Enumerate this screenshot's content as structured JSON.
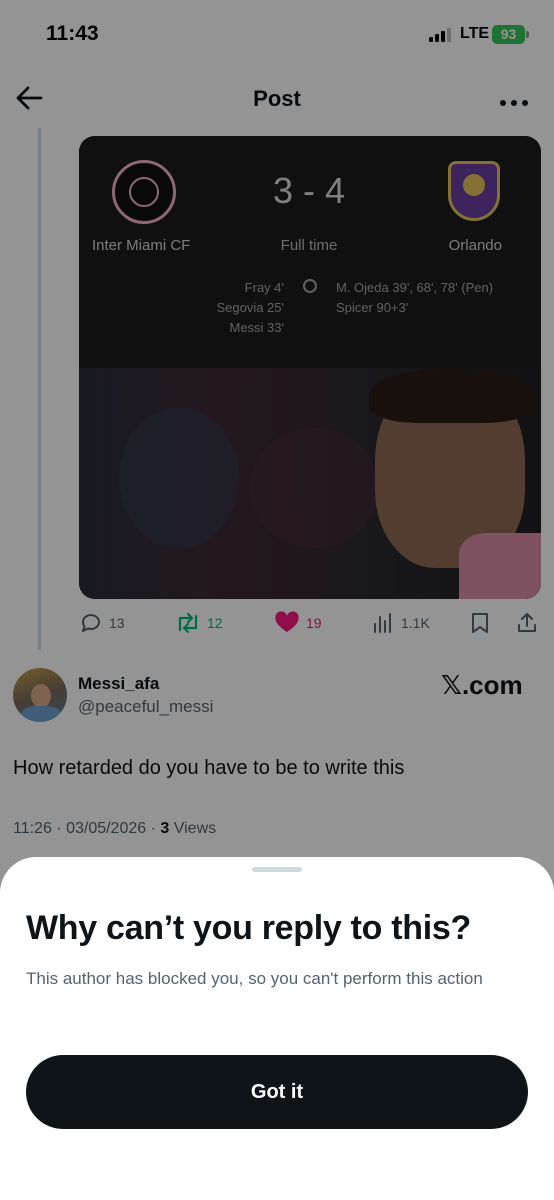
{
  "status_bar": {
    "time": "11:43",
    "network": "LTE",
    "battery": "93"
  },
  "nav": {
    "title": "Post",
    "back_icon": "arrow-left-icon",
    "more_icon": "more-horizontal-icon"
  },
  "match": {
    "score": "3 - 4",
    "status": "Full time",
    "home_team": "Inter Miami CF",
    "away_team": "Orlando",
    "home_scorers": [
      "Fray 4'",
      "Segovia 25'",
      "Messi 33'"
    ],
    "away_scorers": [
      "M. Ojeda 39', 68', 78' (Pen)",
      "Spicer 90+3'"
    ]
  },
  "actions": {
    "replies": "13",
    "reposts": "12",
    "likes": "19",
    "views": "1.1K"
  },
  "author": {
    "display_name": "Messi_afa",
    "handle": "@peaceful_messi",
    "badge": "𝕏.com"
  },
  "post": {
    "text": "How retarded do you have to be to write this",
    "datetime": "11:26 · 03/05/2026 · ",
    "views_count": "3",
    "views_label": " Views"
  },
  "sheet": {
    "title": "Why can’t you reply to this?",
    "body": "This author has blocked you, so you can't perform this action",
    "button": "Got it"
  },
  "colors": {
    "repost": "#00ba7c",
    "like": "#f91880",
    "battery": "#34c759",
    "button": "#0f1419"
  }
}
